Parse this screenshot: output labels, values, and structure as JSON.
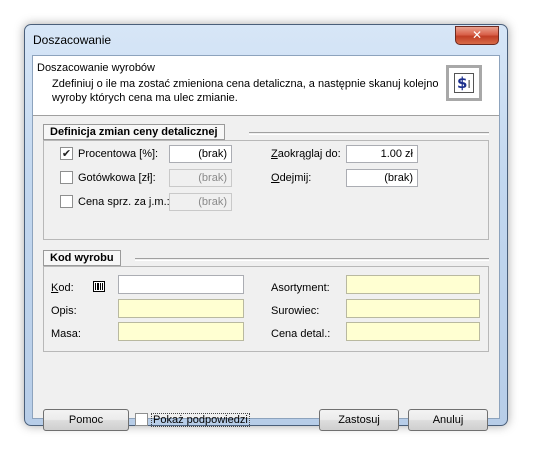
{
  "window": {
    "title": "Doszacowanie",
    "close_glyph": "✕"
  },
  "header": {
    "title": "Doszacowanie wyrobów",
    "description": "Zdefiniuj o ile ma zostać zmieniona cena detaliczna, a następnie skanuj kolejno wyroby których cena ma ulec zmianie.",
    "icon": "price-tag-icon",
    "icon_glyph": "$",
    "icon_cursor": "I"
  },
  "price_section": {
    "title": "Definicja zmian ceny detalicznej",
    "procentowa": {
      "label": "Procentowa [%]:",
      "checked": true,
      "value": "(brak)"
    },
    "gotowkowa": {
      "label": "Gotówkowa [zł]:",
      "checked": false,
      "value": "(brak)"
    },
    "cena_sprz": {
      "label": "Cena sprz. za j.m.:",
      "checked": false,
      "value": "(brak)"
    },
    "zaokraglaj": {
      "label": "Zaokrąglaj do:",
      "value": "1.00 zł"
    },
    "odejmij": {
      "label": "Odejmij:",
      "value": "(brak)"
    }
  },
  "product_section": {
    "title": "Kod wyrobu",
    "kod": {
      "label": "Kod:",
      "value": ""
    },
    "opis": {
      "label": "Opis:",
      "value": ""
    },
    "masa": {
      "label": "Masa:",
      "value": ""
    },
    "asortyment": {
      "label": "Asortyment:",
      "value": ""
    },
    "surowiec": {
      "label": "Surowiec:",
      "value": ""
    },
    "cena_detal": {
      "label": "Cena detal.:",
      "value": ""
    }
  },
  "footer": {
    "help_label": "Pomoc",
    "show_hints_label": "Pokaż podpowiedzi",
    "show_hints_checked": false,
    "apply_label": "Zastosuj",
    "cancel_label": "Anuluj"
  }
}
